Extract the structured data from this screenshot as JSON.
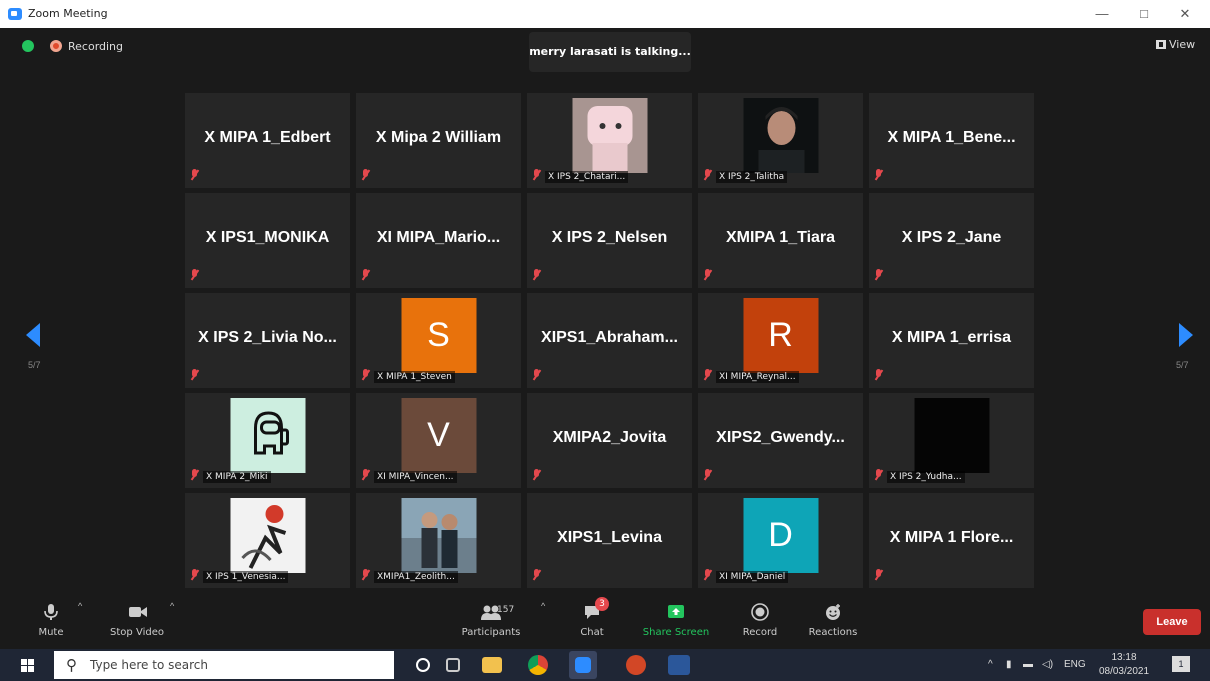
{
  "window": {
    "title": "Zoom Meeting",
    "minimize": "—",
    "maximize": "□",
    "close": "✕"
  },
  "top": {
    "recording_label": "Recording",
    "talking_text": "merry larasati is talking...",
    "view_label": "View"
  },
  "pagination": {
    "left": "5/7",
    "right": "5/7"
  },
  "tiles": [
    {
      "display": "X MIPA 1_Edbert",
      "small": ""
    },
    {
      "display": "X Mipa 2 William",
      "small": ""
    },
    {
      "display": "",
      "small": "X IPS 2_Chatari..."
    },
    {
      "display": "",
      "small": "X IPS 2_Talitha"
    },
    {
      "display": "X MIPA 1_Bene...",
      "small": ""
    },
    {
      "display": "X IPS1_MONIKA",
      "small": ""
    },
    {
      "display": "XI MIPA_Mario...",
      "small": ""
    },
    {
      "display": "X IPS 2_Nelsen",
      "small": ""
    },
    {
      "display": "XMIPA 1_Tiara",
      "small": ""
    },
    {
      "display": "X IPS 2_Jane",
      "small": ""
    },
    {
      "display": "X IPS 2_Livia No...",
      "small": ""
    },
    {
      "display": "S",
      "small": "X MIPA 1_Steven"
    },
    {
      "display": "XIPS1_Abraham...",
      "small": ""
    },
    {
      "display": "R",
      "small": "XI MIPA_Reynal..."
    },
    {
      "display": "X MIPA 1_errisa",
      "small": ""
    },
    {
      "display": "",
      "small": "X MIPA 2_Miki"
    },
    {
      "display": "V",
      "small": "XI MIPA_Vincen..."
    },
    {
      "display": "XMIPA2_Jovita",
      "small": ""
    },
    {
      "display": "XIPS2_Gwendy...",
      "small": ""
    },
    {
      "display": "",
      "small": "X IPS 2_Yudha..."
    },
    {
      "display": "",
      "small": "X IPS 1_Venesia..."
    },
    {
      "display": "",
      "small": "XMIPA1_Zeolith..."
    },
    {
      "display": "XIPS1_Levina",
      "small": ""
    },
    {
      "display": "D",
      "small": "XI MIPA_Daniel"
    },
    {
      "display": "X MIPA 1 Flore...",
      "small": ""
    }
  ],
  "toolbar": {
    "mute": "Mute",
    "stop_video": "Stop Video",
    "participants": "Participants",
    "participants_count": "157",
    "chat": "Chat",
    "chat_badge": "3",
    "share_screen": "Share Screen",
    "record": "Record",
    "reactions": "Reactions",
    "leave": "Leave"
  },
  "taskbar": {
    "search_placeholder": "Type here to search",
    "language": "ENG",
    "time": "13:18",
    "date": "08/03/2021",
    "notifications_count": "1"
  },
  "colors": {
    "accent": "#2d8cff",
    "share_green": "#23c55e",
    "leave_red": "#c9302c",
    "avatar_S": "#e8720c",
    "avatar_R": "#c2410c",
    "avatar_V": "#6b4a3a",
    "avatar_D": "#0ea5b7"
  }
}
